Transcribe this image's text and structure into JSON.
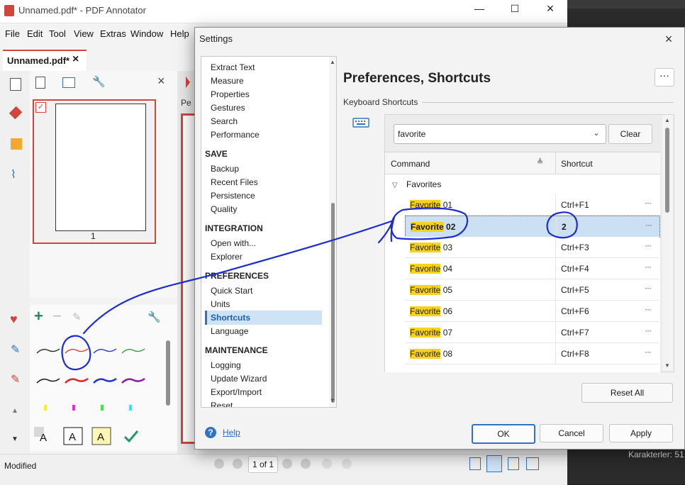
{
  "app": {
    "title": "Unnamed.pdf* - PDF Annotator",
    "menu": [
      "File",
      "Edit",
      "Tool",
      "View",
      "Extras",
      "Window",
      "Help"
    ],
    "doc_tab": "Unnamed.pdf*",
    "doc_tab_close": "×",
    "page_number": "1",
    "docview_label": "Pe",
    "status": "Modified",
    "pager": "1 of 1",
    "right_panel_status": "Karakterler: 51"
  },
  "dialog": {
    "title": "Settings",
    "close": "×",
    "page_title": "Preferences, Shortcuts",
    "more": "···",
    "section": "Keyboard Shortcuts",
    "nav": [
      {
        "label": "Extract Text",
        "kind": "item"
      },
      {
        "label": "Measure",
        "kind": "item"
      },
      {
        "label": "Properties",
        "kind": "item"
      },
      {
        "label": "Gestures",
        "kind": "item"
      },
      {
        "label": "Search",
        "kind": "item"
      },
      {
        "label": "Performance",
        "kind": "item"
      },
      {
        "label": "SAVE",
        "kind": "header"
      },
      {
        "label": "Backup",
        "kind": "item"
      },
      {
        "label": "Recent Files",
        "kind": "item"
      },
      {
        "label": "Persistence",
        "kind": "item"
      },
      {
        "label": "Quality",
        "kind": "item"
      },
      {
        "label": "INTEGRATION",
        "kind": "header"
      },
      {
        "label": "Open with...",
        "kind": "item"
      },
      {
        "label": "Explorer",
        "kind": "item"
      },
      {
        "label": "PREFERENCES",
        "kind": "header"
      },
      {
        "label": "Quick Start",
        "kind": "item"
      },
      {
        "label": "Units",
        "kind": "item"
      },
      {
        "label": "Shortcuts",
        "kind": "selected"
      },
      {
        "label": "Language",
        "kind": "item"
      },
      {
        "label": "MAINTENANCE",
        "kind": "header"
      },
      {
        "label": "Logging",
        "kind": "item"
      },
      {
        "label": "Update Wizard",
        "kind": "item"
      },
      {
        "label": "Export/Import",
        "kind": "item"
      },
      {
        "label": "Reset",
        "kind": "item"
      }
    ],
    "search": {
      "value": "favorite",
      "clear": "Clear"
    },
    "table": {
      "col_command": "Command",
      "col_shortcut": "Shortcut",
      "group": "Favorites",
      "rows": [
        {
          "hl": "Favorite",
          "num": "01",
          "shortcut": "Ctrl+F1",
          "selected": false
        },
        {
          "hl": "Favorite",
          "num": "02",
          "shortcut": "2",
          "selected": true
        },
        {
          "hl": "Favorite",
          "num": "03",
          "shortcut": "Ctrl+F3",
          "selected": false
        },
        {
          "hl": "Favorite",
          "num": "04",
          "shortcut": "Ctrl+F4",
          "selected": false
        },
        {
          "hl": "Favorite",
          "num": "05",
          "shortcut": "Ctrl+F5",
          "selected": false
        },
        {
          "hl": "Favorite",
          "num": "06",
          "shortcut": "Ctrl+F6",
          "selected": false
        },
        {
          "hl": "Favorite",
          "num": "07",
          "shortcut": "Ctrl+F7",
          "selected": false
        },
        {
          "hl": "Favorite",
          "num": "08",
          "shortcut": "Ctrl+F8",
          "selected": false
        }
      ],
      "row_menu": "···"
    },
    "reset_all": "Reset All",
    "help": "Help",
    "ok": "OK",
    "cancel": "Cancel",
    "apply": "Apply"
  },
  "colors": {
    "accent": "#2f74c0",
    "highlight": "#f7d21f",
    "selection": "#cce0f4",
    "brand_red": "#d1453b",
    "ink_annotation": "#1b2bd6"
  }
}
